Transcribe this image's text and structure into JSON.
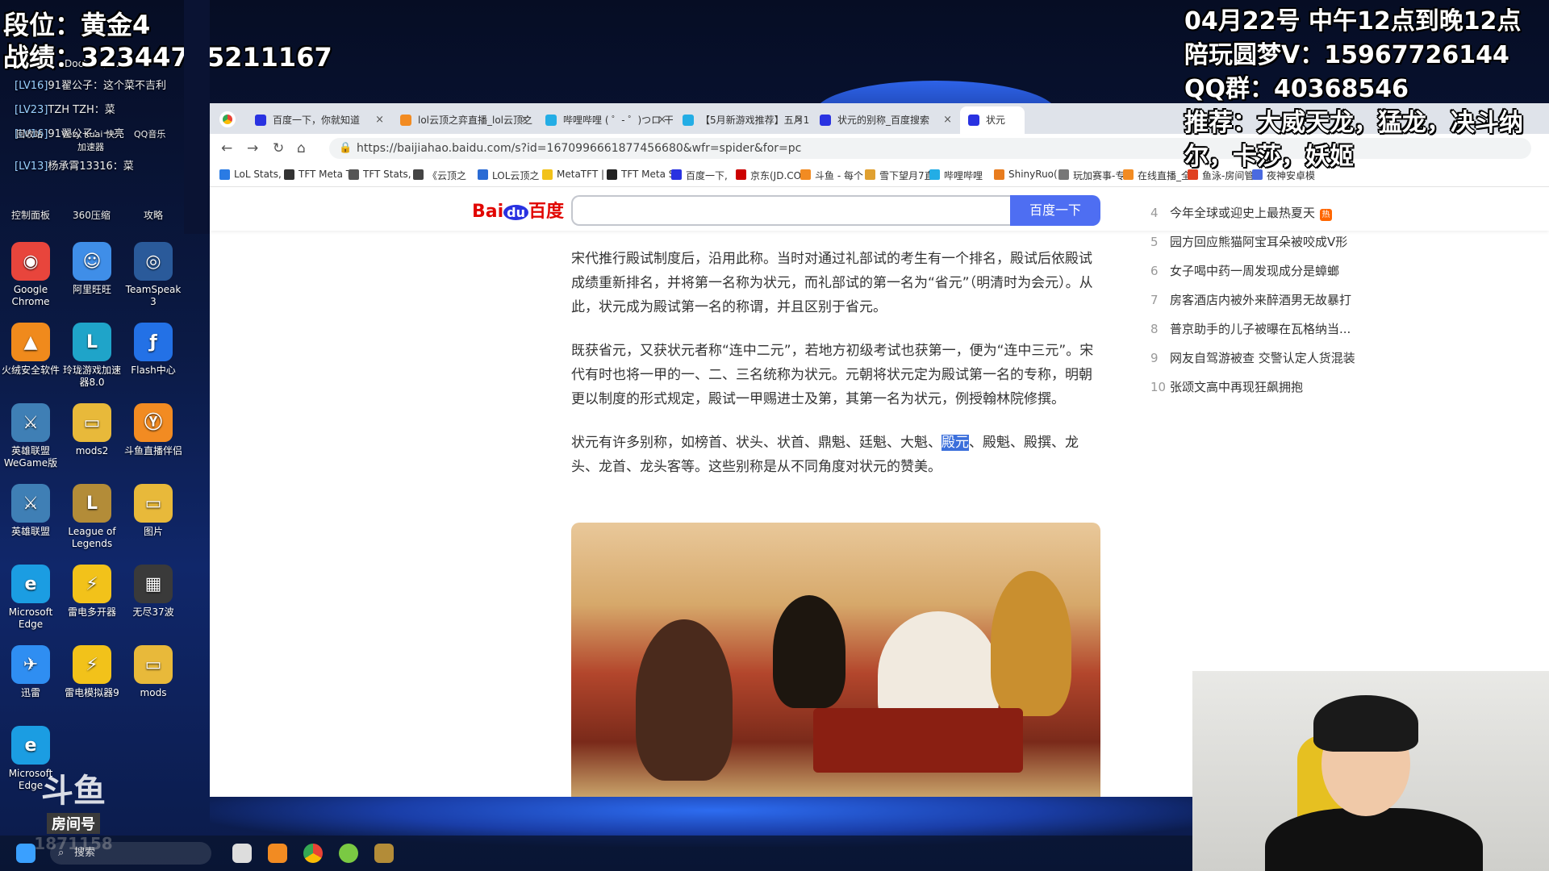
{
  "overlay_left": {
    "rank": "段位：黄金4",
    "record": "战绩：32344755211167",
    "chat": [
      {
        "level": "[LV16]",
        "text": "91翟公子：这个菜不吉利"
      },
      {
        "level": "[LV23]",
        "text": "TZH TZH：菜"
      },
      {
        "level": "[LV16]",
        "text": "91翟公子：一亮"
      },
      {
        "level": "[LV13]",
        "text": "杨承霄13316：菜"
      }
    ],
    "small_labels": [
      "Doctor 书...",
      "回收站",
      "Very Kuai 快",
      "加速器",
      "控制面板",
      "360压缩",
      "攻略",
      "QQ音乐"
    ]
  },
  "overlay_right": {
    "lines": [
      "04月22号 中午12点到晚12点",
      "陪玩圆梦V：15967726144",
      "QQ群：40368546",
      "推荐：大威天龙，猛龙，决斗纳尔，卡莎，妖姬"
    ]
  },
  "desktop_icons": [
    {
      "label": "Google Chrome",
      "color": "#e8453c",
      "glyph": "◉"
    },
    {
      "label": "阿里旺旺",
      "color": "#3f8ee8",
      "glyph": "☺"
    },
    {
      "label": "TeamSpeak 3",
      "color": "#2a5a9a",
      "glyph": "◎"
    },
    {
      "label": "火绒安全软件",
      "color": "#f08a1c",
      "glyph": "▲"
    },
    {
      "label": "玲珑游戏加速器8.0",
      "color": "#1fa4c9",
      "glyph": "L"
    },
    {
      "label": "Flash中心",
      "color": "#2371e6",
      "glyph": "ƒ"
    },
    {
      "label": "英雄联盟WeGame版",
      "color": "#3f7fb5",
      "glyph": "⚔"
    },
    {
      "label": "mods2",
      "color": "#e8b93a",
      "glyph": "▭"
    },
    {
      "label": "斗鱼直播伴侣",
      "color": "#f28b22",
      "glyph": "Ⓨ"
    },
    {
      "label": "英雄联盟",
      "color": "#3f7fb5",
      "glyph": "⚔"
    },
    {
      "label": "League of Legends",
      "color": "#b38c38",
      "glyph": "L"
    },
    {
      "label": "图片",
      "color": "#e8b93a",
      "glyph": "▭"
    },
    {
      "label": "Microsoft Edge",
      "color": "#1b9de2",
      "glyph": "e"
    },
    {
      "label": "雷电多开器",
      "color": "#f2c21a",
      "glyph": "⚡"
    },
    {
      "label": "无尽37波",
      "color": "#3a3a3a",
      "glyph": "▦"
    },
    {
      "label": "迅雷",
      "color": "#2f8ef2",
      "glyph": "✈"
    },
    {
      "label": "雷电模拟器9",
      "color": "#f2c21a",
      "glyph": "⚡"
    },
    {
      "label": "mods",
      "color": "#e8b93a",
      "glyph": "▭"
    },
    {
      "label": "Microsoft Edge",
      "color": "#1b9de2",
      "glyph": "e"
    }
  ],
  "room": {
    "logo": "斗鱼",
    "label": "房间号",
    "number": "1871158"
  },
  "browser": {
    "tabs": [
      {
        "label": "百度一下，你就知道",
        "color": "#2932e1"
      },
      {
        "label": "lol云顶之弈直播_lol云顶之",
        "color": "#f28b22"
      },
      {
        "label": "哔哩哔哩 ( ゜- ゜)つロ 干杯~",
        "color": "#23ade5"
      },
      {
        "label": "【5月新游戏推荐】五月1!",
        "color": "#23ade5"
      },
      {
        "label": "状元的别称_百度搜索",
        "color": "#2932e1"
      },
      {
        "label": "状元",
        "color": "#2932e1"
      }
    ],
    "url": "https://baijiahao.baidu.com/s?id=1670996661877456680&wfr=spider&for=pc",
    "bookmarks": [
      "LoL Stats, F",
      "TFT Meta T",
      "TFT Stats, I",
      "《云顶之",
      "LOL云顶之",
      "MetaTFT |",
      "TFT Meta S",
      "百度一下,",
      "京东(JD.CO",
      "斗鱼 - 每个",
      "雪下望月7直",
      "哔哩哔哩",
      "ShinyRuo(",
      "玩加赛事-专",
      "在线直播_全",
      "鱼泳-房间管",
      "夜神安卓模"
    ],
    "search_button": "百度一下",
    "logo_bai": "Bai",
    "logo_du": "du",
    "logo_baidu": "百度"
  },
  "article": {
    "p1": "宋代推行殿试制度后，沿用此称。当时对通过礼部试的考生有一个排名，殿试后依殿试成绩重新排名，并将第一名称为状元，而礼部试的第一名为“省元”（明清时为会元）。从此，状元成为殿试第一名的称谓，并且区别于省元。",
    "p2": "既获省元，又获状元者称“连中二元”，若地方初级考试也获第一，便为“连中三元”。宋代有时也将一甲的一、二、三名统称为状元。元朝将状元定为殿试第一名的专称，明朝更以制度的形式规定，殿试一甲赐进士及第，其第一名为状元，例授翰林院修撰。",
    "p3_before": "状元有许多别称，如榜首、状头、状首、鼎魁、廷魁、大魁、",
    "p3_highlight": "殿元",
    "p3_after": "、殿魁、殿撰、龙头、龙首、龙头客等。这些别称是从不同角度对状元的赞美。"
  },
  "hot_list": [
    {
      "num": "4",
      "text": "今年全球或迎史上最热夏天",
      "badge": "热"
    },
    {
      "num": "5",
      "text": "园方回应熊猫阿宝耳朵被咬成V形",
      "badge": ""
    },
    {
      "num": "6",
      "text": "女子喝中药一周发现成分是蟑螂",
      "badge": ""
    },
    {
      "num": "7",
      "text": "房客酒店内被外来醉酒男无故暴打",
      "badge": ""
    },
    {
      "num": "8",
      "text": "普京助手的儿子被曝在瓦格纳当...",
      "badge": ""
    },
    {
      "num": "9",
      "text": "网友自驾游被查 交警认定人货混装",
      "badge": ""
    },
    {
      "num": "10",
      "text": "张颂文高中再现狂飙拥抱",
      "badge": ""
    }
  ],
  "taskbar": {
    "search": "搜索"
  }
}
